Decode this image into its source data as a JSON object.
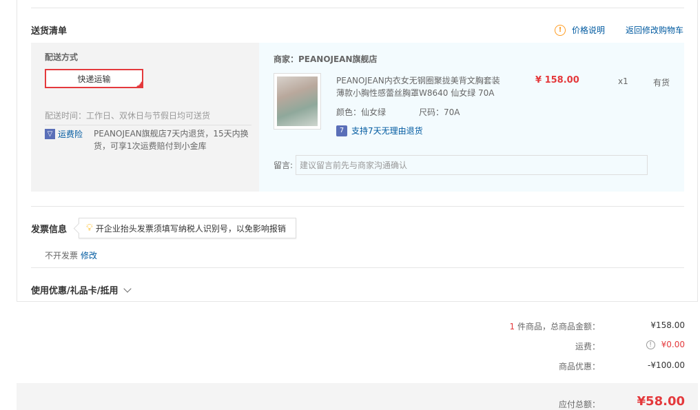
{
  "delivery": {
    "section_title": "送货清单",
    "price_note": "价格说明",
    "back_to_cart": "返回修改购物车",
    "method_label": "配送方式",
    "method_value": "快递运输",
    "time_text": "配送时间：工作日、双休日与节假日均可送货",
    "insurance_label": "运费险",
    "insurance_desc": "PEANOJEAN旗舰店7天内退货，15天内换货，可享1次运费赔付到小金库"
  },
  "shop": {
    "name": "商家：PEANOJEAN旗舰店",
    "product": {
      "title_line1": "PEANOJEAN内衣女无钢圈聚拢美背文胸套装",
      "title_line2": "薄款小胸性感蕾丝胸罩W8640 仙女绿 70A",
      "price": "¥ 158.00",
      "qty": "x1",
      "stock": "有货",
      "color": "颜色：仙女绿",
      "size": "尺码：70A",
      "return_policy": "支持7天无理由退货"
    },
    "remark_label": "留言:",
    "remark_placeholder": "建议留言前先与商家沟通确认"
  },
  "invoice": {
    "title": "发票信息",
    "tip": "开企业抬头发票须填写纳税人识别号，以免影响报销",
    "status": "不开发票",
    "modify": "修改"
  },
  "coupon": {
    "title": "使用优惠/礼品卡/抵用"
  },
  "summary": {
    "count": "1",
    "items_label": "件商品，总商品金额：",
    "items_amount": "¥158.00",
    "shipping_label": "运费：",
    "shipping_amount": "¥0.00",
    "discount_label": "商品优惠：",
    "discount_amount": "-¥100.00",
    "total_label": "应付总额：",
    "total_amount": "¥58.00"
  },
  "colors": {
    "accent_red": "#e4393c",
    "link_blue": "#005aa0",
    "warn_orange": "#ff9b20"
  }
}
